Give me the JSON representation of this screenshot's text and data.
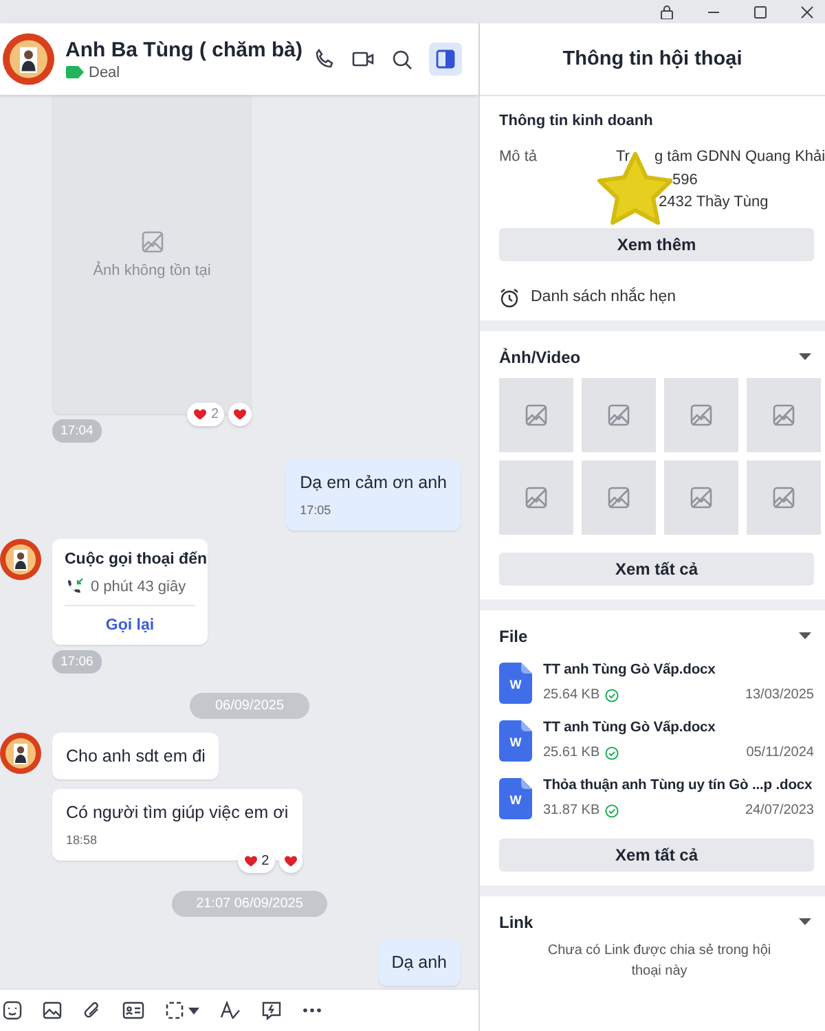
{
  "chat_header": {
    "name": "Anh Ba Tùng ( chăm bà)",
    "tag": {
      "label": "Deal",
      "color": "#22b45a"
    },
    "info_panel_open": true
  },
  "messages": [
    {
      "kind": "image",
      "outgoing": false,
      "avatar": false,
      "text": "Ảnh không tồn tại",
      "time_below": "17:04",
      "reaction_count": "2",
      "reacted": true
    },
    {
      "kind": "text",
      "outgoing": true,
      "text": "Dạ em cảm ơn anh",
      "time": "17:05"
    },
    {
      "kind": "call",
      "outgoing": false,
      "avatar": true,
      "title": "Cuộc gọi thoại đến",
      "duration": "0 phút 43 giây",
      "action": "Gọi lại",
      "time_below": "17:06"
    },
    {
      "kind": "divider",
      "text": "06/09/2025"
    },
    {
      "kind": "text",
      "outgoing": false,
      "avatar": true,
      "text": "Cho anh sdt em đi"
    },
    {
      "kind": "text",
      "outgoing": false,
      "avatar": false,
      "text": "Có người tìm giúp việc em ơi",
      "time": "18:58",
      "reaction_count": "2",
      "reacted": true
    },
    {
      "kind": "divider",
      "text": "21:07 06/09/2025"
    },
    {
      "kind": "text",
      "outgoing": true,
      "text": "Dạ anh"
    }
  ],
  "info_panel": {
    "title": "Thông tin hội thoại",
    "business": {
      "heading": "Thông tin kinh doanh",
      "label": "Mô tả",
      "lines": [
        [
          "Tr",
          "g tâm GDNN Quang Khải"
        ],
        [
          "596"
        ],
        [
          "2432 Thầy Tùng"
        ]
      ],
      "more": "Xem thêm"
    },
    "reminders": "Danh sách nhắc hẹn",
    "media": {
      "heading": "Ảnh/Video",
      "expanded": true,
      "tiles": [
        {
          "kind": "missing"
        },
        {
          "kind": "missing"
        },
        {
          "kind": "missing"
        },
        {
          "kind": "missing"
        },
        {
          "kind": "missing"
        },
        {
          "kind": "missing"
        },
        {
          "kind": "missing"
        },
        {
          "kind": "missing"
        }
      ],
      "view_all": "Xem tất cả"
    },
    "files": {
      "heading": "File",
      "expanded": true,
      "items": [
        {
          "badge": "W",
          "name": "TT anh Tùng Gò Vấp.docx",
          "size": "25.64 KB",
          "synced": true,
          "date": "13/03/2025"
        },
        {
          "badge": "W",
          "name": "TT anh Tùng Gò Vấp.docx",
          "size": "25.61 KB",
          "synced": true,
          "date": "05/11/2024"
        },
        {
          "badge": "W",
          "name": "Thỏa thuận anh Tùng uy tín Gò ...p  .docx",
          "size": "31.87 KB",
          "synced": true,
          "date": "24/07/2023"
        }
      ],
      "view_all": "Xem tất cả"
    },
    "links": {
      "heading": "Link",
      "expanded": true,
      "empty": "Chưa có Link được chia sẻ trong hội thoại này"
    }
  }
}
